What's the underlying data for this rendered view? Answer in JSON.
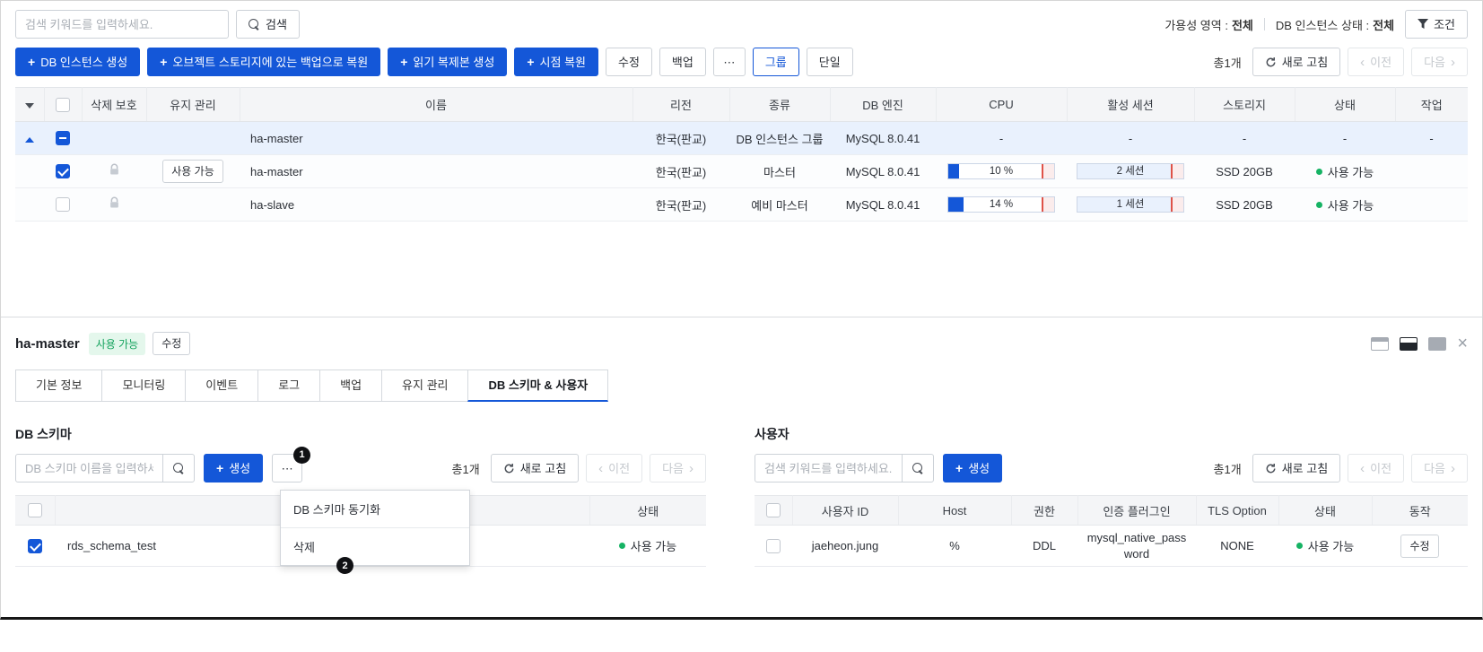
{
  "icons": {
    "plus": "+",
    "chevron_left": "‹",
    "chevron_right": "›",
    "close": "×",
    "more": "⋯"
  },
  "filter_bar": {
    "search_placeholder": "검색 키워드를 입력하세요.",
    "search_button": "검색",
    "availability": {
      "label": "가용성 영역 :",
      "value": "전체"
    },
    "instance_status": {
      "label": "DB 인스턴스 상태 :",
      "value": "전체"
    },
    "condition_button": "조건"
  },
  "toolbar": {
    "create_instance": "DB 인스턴스 생성",
    "restore_from_object_storage": "오브젝트 스토리지에 있는 백업으로 복원",
    "create_read_replica": "읽기 복제본 생성",
    "point_in_time_restore": "시점 복원",
    "edit": "수정",
    "backup": "백업",
    "group": "그룹",
    "single": "단일",
    "total": "총1개",
    "refresh": "새로 고침",
    "prev": "이전",
    "next": "다음"
  },
  "instance_table": {
    "columns": [
      "삭제 보호",
      "유지 관리",
      "이름",
      "리전",
      "종류",
      "DB 엔진",
      "CPU",
      "활성 세션",
      "스토리지",
      "상태",
      "작업"
    ],
    "rows": [
      {
        "name": "ha-master",
        "region": "한국(판교)",
        "kind": "DB 인스턴스 그룹",
        "engine": "MySQL 8.0.41",
        "cpu": "-",
        "sessions": "-",
        "storage": "-",
        "status": "-",
        "action": "-",
        "checkbox": "indeterminate",
        "expanded": true
      },
      {
        "name": "ha-master",
        "maintenance": "사용 가능",
        "region": "한국(판교)",
        "kind": "마스터",
        "engine": "MySQL 8.0.41",
        "cpu_pct": 10,
        "cpu_label": "10 %",
        "session_label": "2 세션",
        "storage": "SSD 20GB",
        "status": "사용 가능",
        "checkbox": "checked",
        "delete_protection": "lock"
      },
      {
        "name": "ha-slave",
        "region": "한국(판교)",
        "kind": "예비 마스터",
        "engine": "MySQL 8.0.41",
        "cpu_pct": 14,
        "cpu_label": "14 %",
        "session_label": "1 세션",
        "storage": "SSD 20GB",
        "status": "사용 가능",
        "checkbox": "unchecked",
        "delete_protection": "lock"
      }
    ]
  },
  "detail": {
    "title": "ha-master",
    "status_badge": "사용 가능",
    "edit_button": "수정",
    "tabs": [
      "기본 정보",
      "모니터링",
      "이벤트",
      "로그",
      "백업",
      "유지 관리",
      "DB 스키마 & 사용자"
    ],
    "active_tab": "DB 스키마 & 사용자",
    "annotations": [
      "1",
      "2"
    ],
    "schema": {
      "title": "DB 스키마",
      "search_placeholder": "DB 스키마 이름을 입력하세요.",
      "create": "생성",
      "menu": [
        "DB 스키마 동기화",
        "삭제"
      ],
      "total": "총1개",
      "refresh": "새로 고침",
      "prev": "이전",
      "next": "다음",
      "columns": [
        "이름",
        "상태"
      ],
      "rows": [
        {
          "name": "rds_schema_test",
          "status": "사용 가능",
          "checkbox": "checked"
        }
      ]
    },
    "users": {
      "title": "사용자",
      "search_placeholder": "검색 키워드를 입력하세요.",
      "create": "생성",
      "total": "총1개",
      "refresh": "새로 고침",
      "prev": "이전",
      "next": "다음",
      "columns": [
        "사용자 ID",
        "Host",
        "권한",
        "인증 플러그인",
        "TLS Option",
        "상태",
        "동작"
      ],
      "rows": [
        {
          "user_id": "jaeheon.jung",
          "host": "%",
          "privilege": "DDL",
          "plugin": "mysql_native_password",
          "tls_option": "NONE",
          "status": "사용 가능",
          "action": "수정"
        }
      ]
    }
  }
}
